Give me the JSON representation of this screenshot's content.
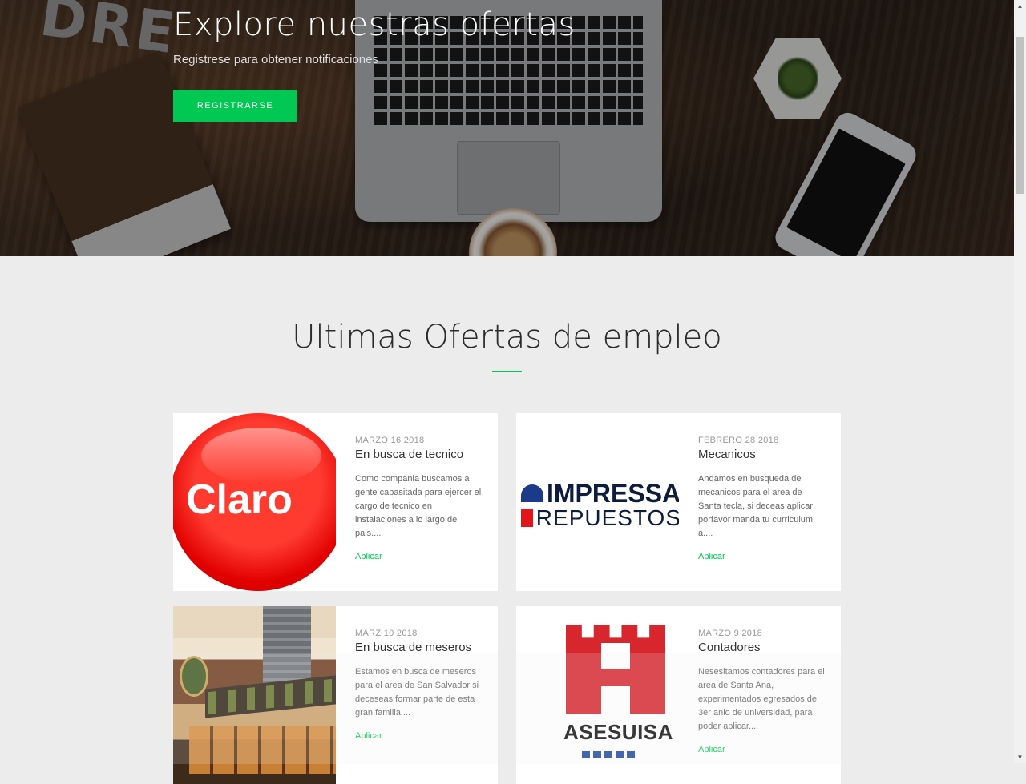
{
  "hero": {
    "title": "Explore nuestras ofertas",
    "subtitle": "Registrese para obtener notificaciones",
    "register_button": "REGISTRARSE"
  },
  "section": {
    "title": "Ultimas Ofertas de empleo"
  },
  "colors": {
    "accent": "#00c853"
  },
  "offers": [
    {
      "logo": "Claro",
      "date": "MARZO 16 2018",
      "title": "En busca de tecnico",
      "description": "Como compania buscamos a gente capasitada para ejercer el cargo de tecnico en instalaciones a lo largo del pais....",
      "apply_label": "Aplicar"
    },
    {
      "logo": "IMPRESSA REPUESTOS",
      "logo_line1": "IMPRESSA",
      "logo_line2": "REPUESTOS",
      "date": "FEBRERO 28 2018",
      "title": "Mecanicos",
      "description": "Andamos en busqueda de mecanicos para el area de Santa tecla, si deceas aplicar porfavor manda tu curriculum a....",
      "apply_label": "Aplicar"
    },
    {
      "logo": "restaurant-photo",
      "date": "MARZ 10 2018",
      "title": "En busca de meseros",
      "description": "Estamos en busca de meseros para el area de San Salvador si deceseas formar parte de esta gran familia....",
      "apply_label": "Aplicar"
    },
    {
      "logo": "ASESUISA",
      "date": "MARZO 9 2018",
      "title": "Contadores",
      "description": "Nesesitamos contadores para el area de Santa Ana, experimentados egresados de 3er anio de universidad, para poder aplicar....",
      "apply_label": "Aplicar"
    }
  ]
}
